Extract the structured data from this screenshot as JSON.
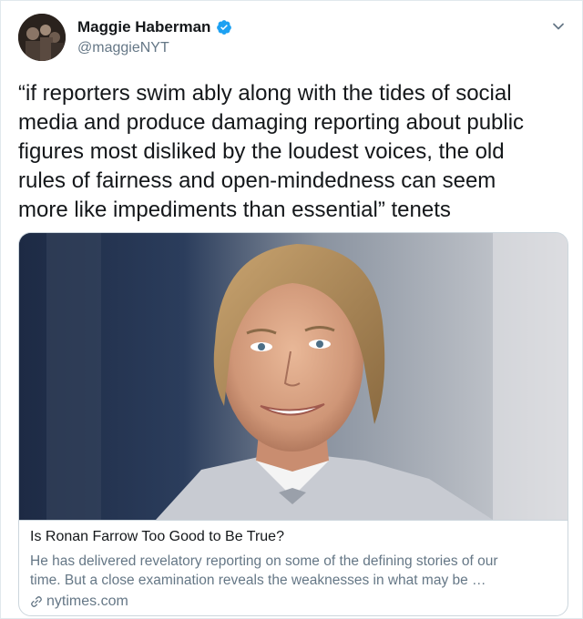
{
  "tweet": {
    "author_name": "Maggie Haberman",
    "author_handle": "@maggieNYT",
    "text_lines": [
      "“if reporters swim ably along with the tides of social",
      "media and produce damaging reporting about public",
      "figures most disliked by the loudest voices, the old",
      "rules of fairness and open-mindedness can seem",
      "more like impediments than essential” tenets"
    ],
    "verified_icon": "verified-badge-icon",
    "menu_icon": "chevron-down-icon"
  },
  "card": {
    "title": "Is Ronan Farrow Too Good to Be True?",
    "description_lines": [
      "He has delivered revelatory reporting on some of the defining stories of our",
      "time. But a close examination reveals the weaknesses in what may be …"
    ],
    "domain": "nytimes.com",
    "link_icon": "link-icon"
  },
  "colors": {
    "text": "#14171a",
    "secondary": "#657786",
    "verified": "#1da1f2",
    "border": "#ccd6dd"
  }
}
